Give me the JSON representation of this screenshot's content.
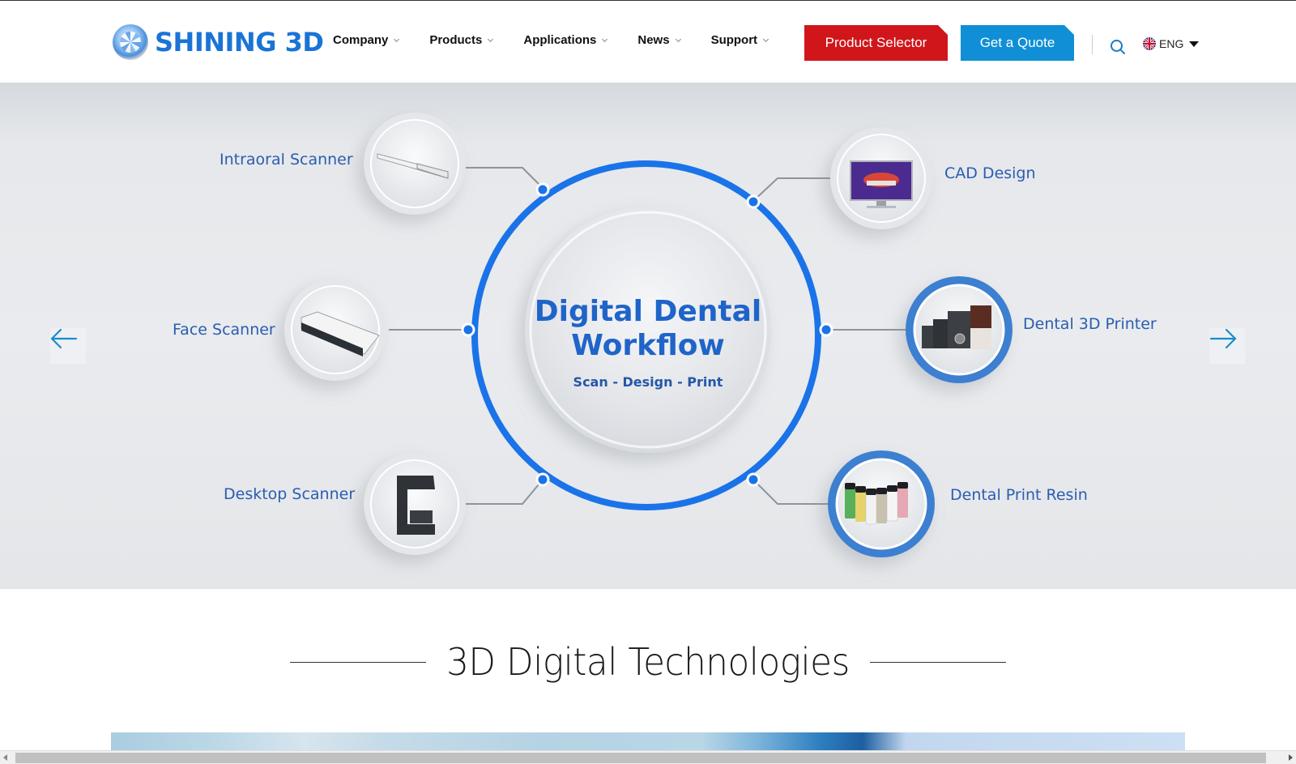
{
  "header": {
    "brand": "SHINING 3D",
    "nav": [
      {
        "label": "Company"
      },
      {
        "label": "Products"
      },
      {
        "label": "Applications"
      },
      {
        "label": "News"
      },
      {
        "label": "Support"
      }
    ],
    "product_selector_label": "Product Selector",
    "get_quote_label": "Get a Quote",
    "search_icon": "search-icon",
    "language": "ENG",
    "colors": {
      "brand": "#1a74d6",
      "selector": "#d0161b",
      "quote": "#108fd6"
    }
  },
  "hero": {
    "title_line1": "Digital Dental",
    "title_line2": "Workflow",
    "subtitle": "Scan - Design - Print",
    "nodes": [
      {
        "label": "Intraoral Scanner",
        "icon": "intraoral-scanner-image"
      },
      {
        "label": "Face Scanner",
        "icon": "face-scanner-image"
      },
      {
        "label": "Desktop Scanner",
        "icon": "desktop-scanner-image"
      },
      {
        "label": "CAD Design",
        "icon": "cad-monitor-image"
      },
      {
        "label": "Dental 3D Printer",
        "icon": "printer-image"
      },
      {
        "label": "Dental Print Resin",
        "icon": "resin-bottles-image"
      }
    ],
    "prev_icon": "arrow-left-icon",
    "next_icon": "arrow-right-icon",
    "accent": "#1a73e8"
  },
  "section": {
    "title": "3D Digital Technologies"
  }
}
